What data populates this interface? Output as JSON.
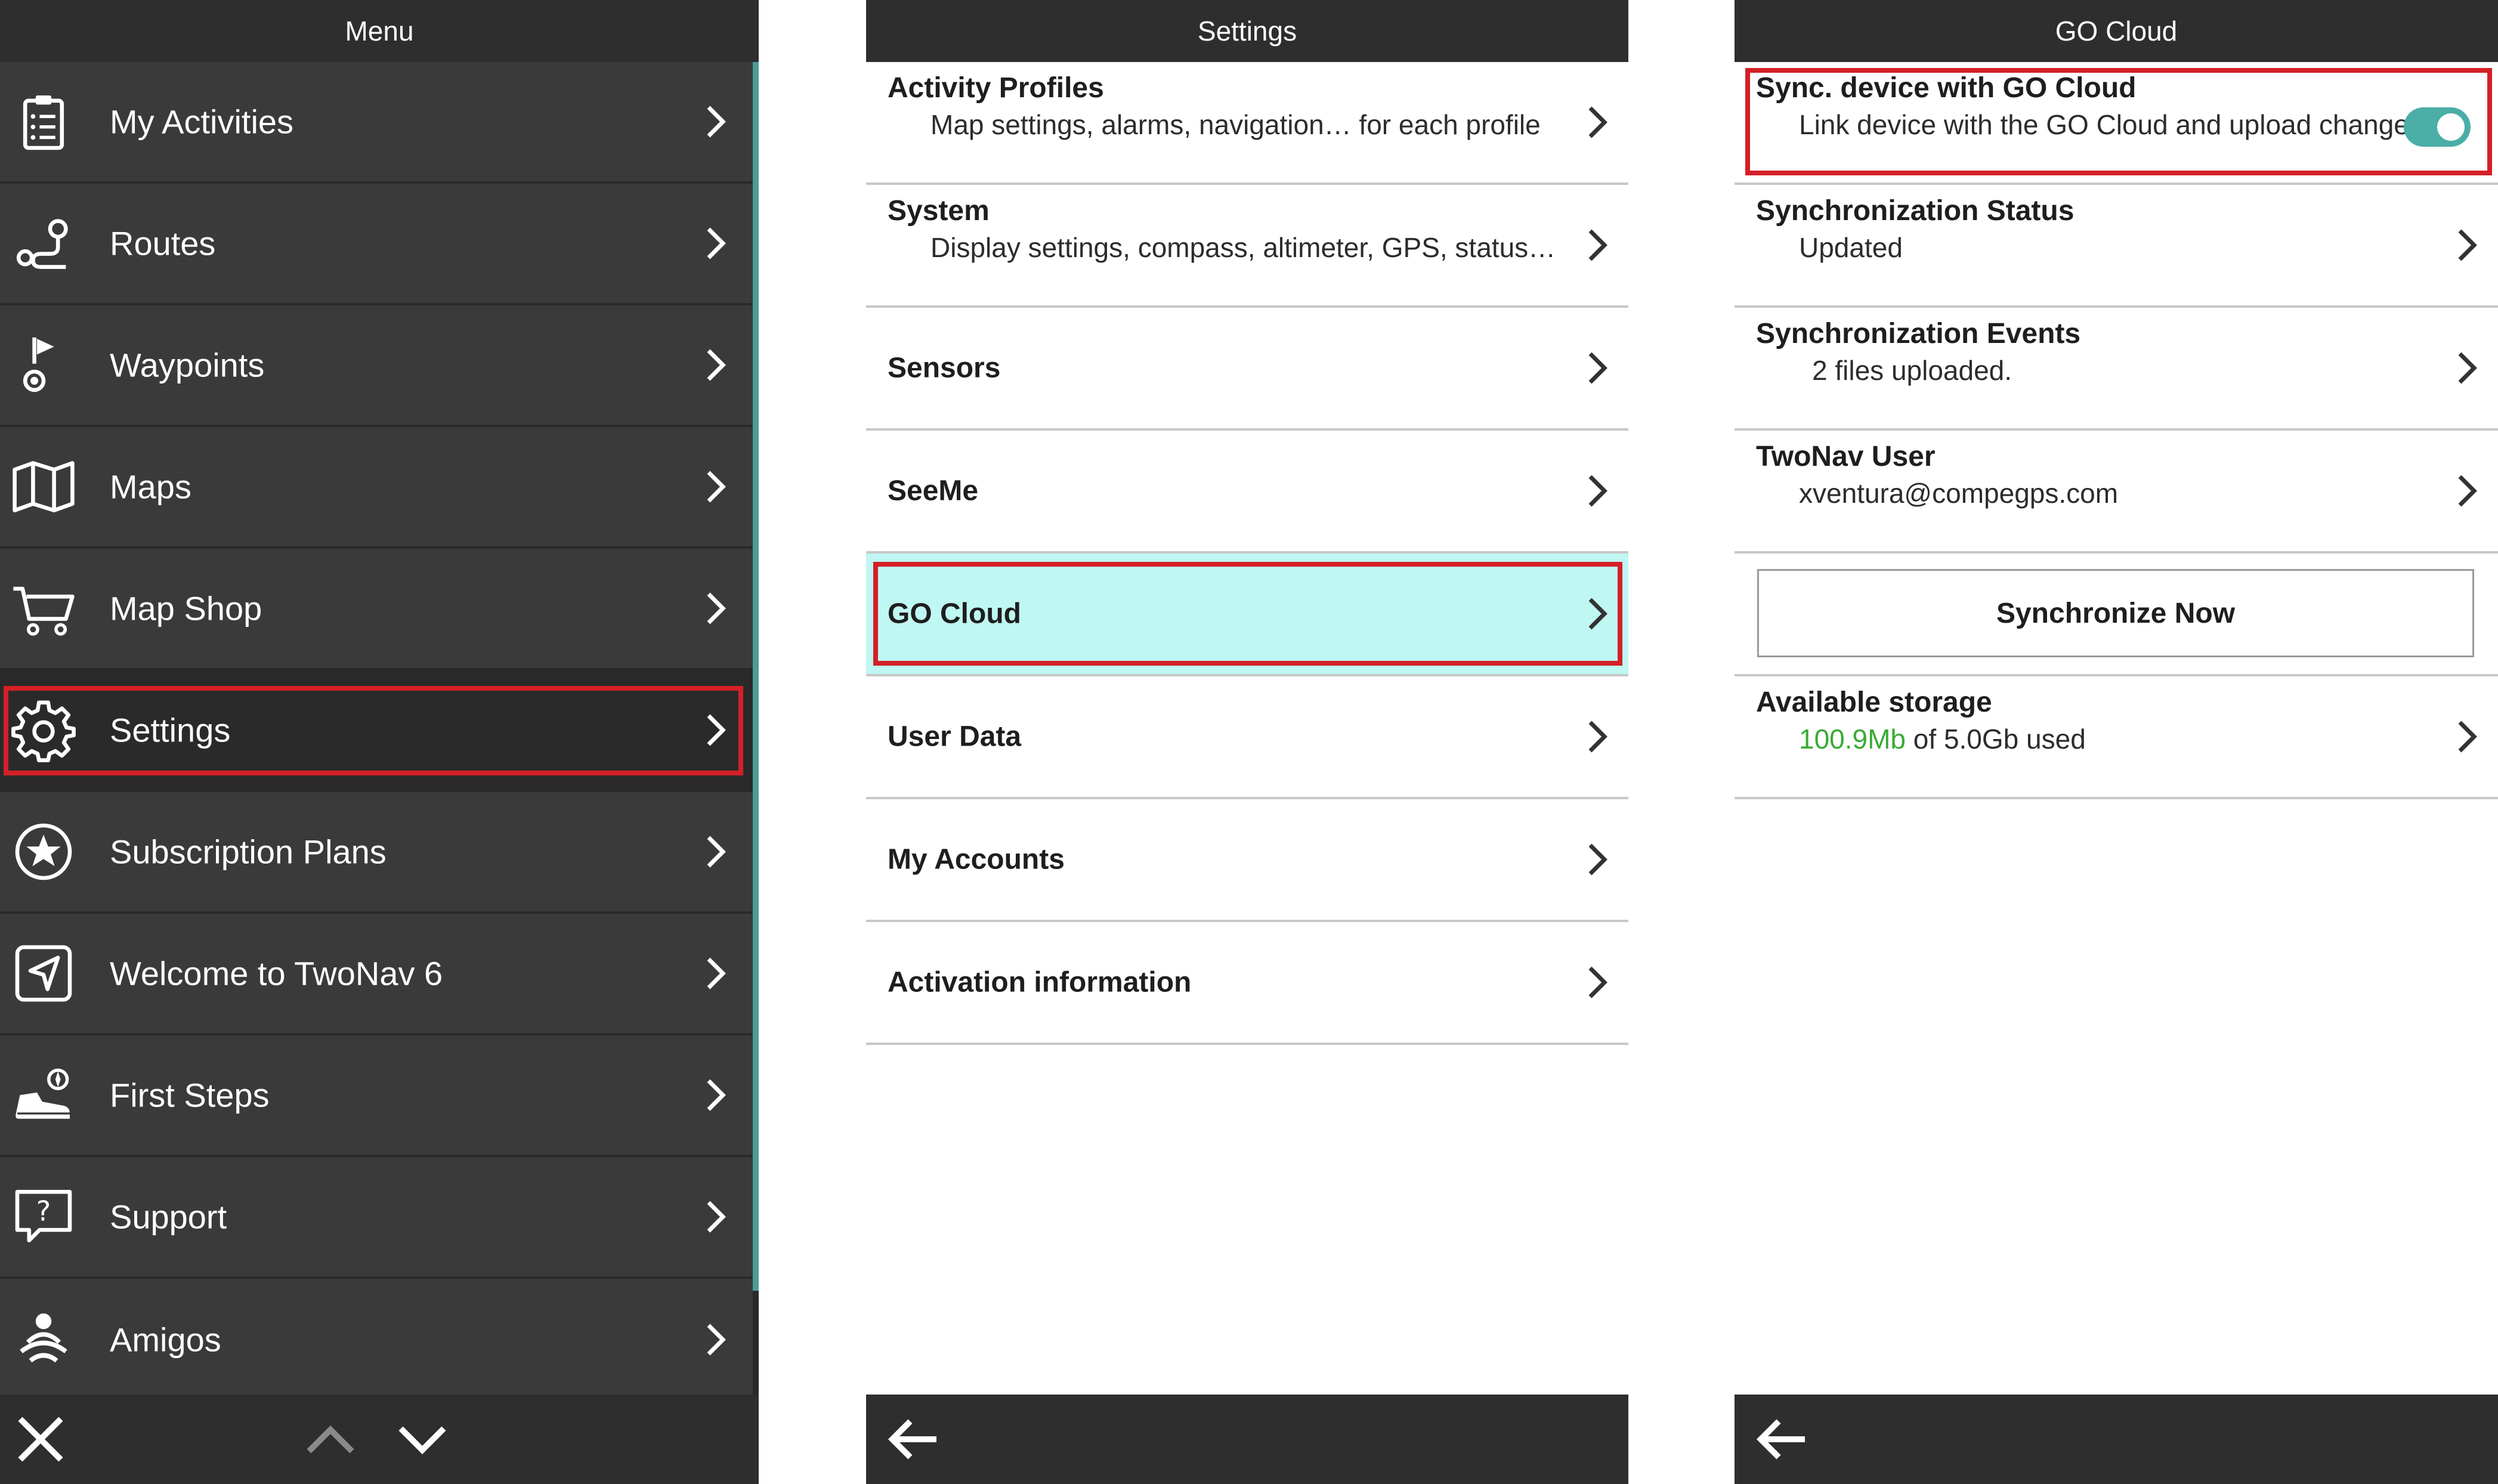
{
  "menu": {
    "title": "Menu",
    "items": [
      {
        "label": "My Activities",
        "icon": "clipboard-icon"
      },
      {
        "label": "Routes",
        "icon": "route-icon"
      },
      {
        "label": "Waypoints",
        "icon": "waypoint-icon"
      },
      {
        "label": "Maps",
        "icon": "map-icon"
      },
      {
        "label": "Map Shop",
        "icon": "cart-icon"
      },
      {
        "label": "Settings",
        "icon": "gear-icon"
      },
      {
        "label": "Subscription Plans",
        "icon": "star-icon"
      },
      {
        "label": "Welcome to TwoNav 6",
        "icon": "navigation-icon"
      },
      {
        "label": "First Steps",
        "icon": "boot-icon"
      },
      {
        "label": "Support",
        "icon": "help-icon"
      },
      {
        "label": "Amigos",
        "icon": "amigos-icon"
      }
    ],
    "selected_index": 5
  },
  "settings": {
    "title": "Settings",
    "items": [
      {
        "title": "Activity Profiles",
        "subtitle": "Map settings, alarms, navigation… for each profile"
      },
      {
        "title": "System",
        "subtitle": "Display settings, compass, altimeter, GPS, status…"
      },
      {
        "title": "Sensors"
      },
      {
        "title": "SeeMe"
      },
      {
        "title": "GO Cloud"
      },
      {
        "title": "User Data"
      },
      {
        "title": "My Accounts"
      },
      {
        "title": "Activation information"
      }
    ],
    "selected_index": 4
  },
  "gocloud": {
    "title": "GO Cloud",
    "sync_device": {
      "title": "Sync. device with GO Cloud",
      "subtitle": "Link device with the GO Cloud and upload changes",
      "enabled": true
    },
    "sync_status": {
      "title": "Synchronization Status",
      "value": "Updated"
    },
    "sync_events": {
      "title": "Synchronization Events",
      "value": "2 files uploaded."
    },
    "user": {
      "title": "TwoNav User",
      "value": "xventura@compegps.com"
    },
    "sync_now_label": "Synchronize Now",
    "storage": {
      "title": "Available storage",
      "used": "100.9Mb",
      "rest": " of 5.0Gb used"
    }
  },
  "colors": {
    "highlight": "#d42027",
    "accent": "#4aaea6",
    "active_row": "#bff7f2",
    "storage_used": "#3aaa35"
  }
}
